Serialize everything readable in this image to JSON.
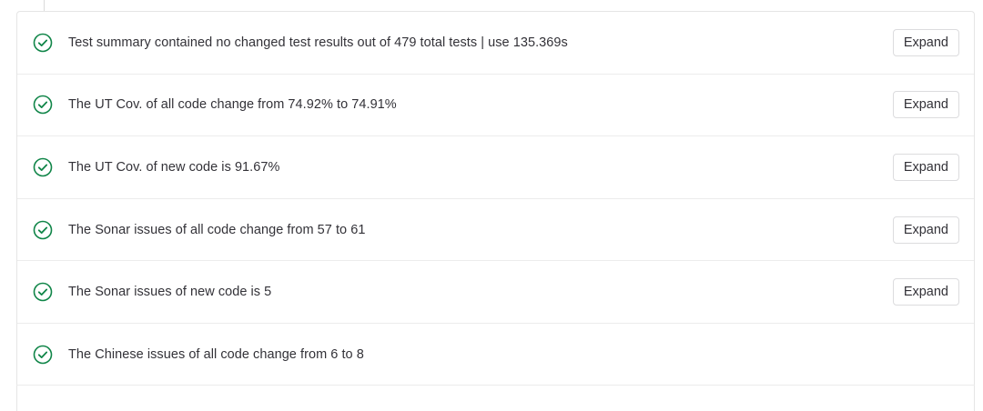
{
  "checks": [
    {
      "text": "Test summary contained no changed test results out of 479 total tests | use 135.369s",
      "status": "success",
      "icon": "check-circle-icon",
      "button": "Expand"
    },
    {
      "text": "The UT Cov. of all code change from 74.92% to 74.91%",
      "status": "success",
      "icon": "check-circle-icon",
      "button": "Expand"
    },
    {
      "text": "The UT Cov. of new code is 91.67%",
      "status": "success",
      "icon": "check-circle-icon",
      "button": "Expand"
    },
    {
      "text": "The Sonar issues of all code change from 57 to 61",
      "status": "success",
      "icon": "check-circle-icon",
      "button": "Expand"
    },
    {
      "text": "The Sonar issues of new code is 5",
      "status": "success",
      "icon": "check-circle-icon",
      "button": "Expand"
    },
    {
      "text": "The Chinese issues of all code change from 6 to 8",
      "status": "success",
      "icon": "check-circle-icon",
      "button": null
    }
  ],
  "colors": {
    "success": "#108548",
    "text": "#333238",
    "border": "#e5e5e5"
  }
}
